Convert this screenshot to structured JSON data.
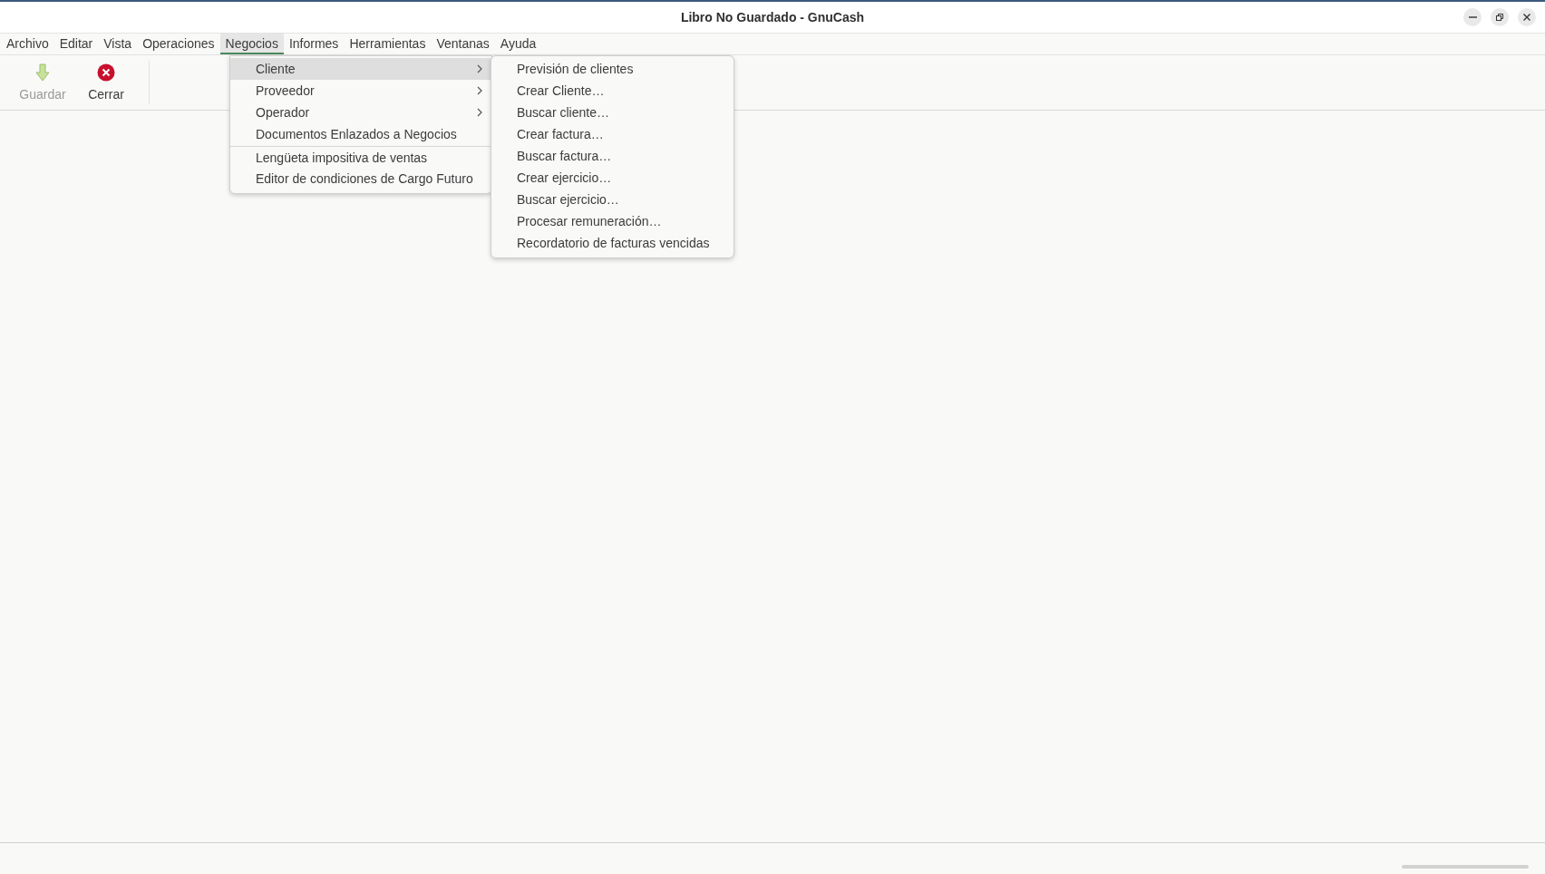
{
  "window": {
    "title": "Libro No Guardado - GnuCash"
  },
  "menubar": [
    {
      "label": "Archivo",
      "selected": false
    },
    {
      "label": "Editar",
      "selected": false
    },
    {
      "label": "Vista",
      "selected": false
    },
    {
      "label": "Operaciones",
      "selected": false
    },
    {
      "label": "Negocios",
      "selected": true
    },
    {
      "label": "Informes",
      "selected": false
    },
    {
      "label": "Herramientas",
      "selected": false
    },
    {
      "label": "Ventanas",
      "selected": false
    },
    {
      "label": "Ayuda",
      "selected": false
    }
  ],
  "toolbar": [
    {
      "label": "Guardar",
      "kind": "save",
      "disabled": true
    },
    {
      "label": "Cerrar",
      "kind": "close",
      "disabled": false
    }
  ],
  "menu": [
    {
      "label": "Cliente",
      "has_submenu": true,
      "selected": true,
      "separator_before": false
    },
    {
      "label": "Proveedor",
      "has_submenu": true,
      "selected": false,
      "separator_before": false
    },
    {
      "label": "Operador",
      "has_submenu": true,
      "selected": false,
      "separator_before": false
    },
    {
      "label": "Documentos Enlazados a Negocios",
      "has_submenu": false,
      "selected": false,
      "separator_before": false
    },
    {
      "label": "Lengüeta impositiva de ventas",
      "has_submenu": false,
      "selected": false,
      "separator_before": true
    },
    {
      "label": "Editor de condiciones de Cargo Futuro",
      "has_submenu": false,
      "selected": false,
      "separator_before": false
    }
  ],
  "submenu": [
    "Previsión de clientes",
    "Crear Cliente…",
    "Buscar cliente…",
    "Crear factura…",
    "Buscar factura…",
    "Crear ejercicio…",
    "Buscar ejercicio…",
    "Procesar remuneración…",
    "Recordatorio de facturas vencidas"
  ]
}
